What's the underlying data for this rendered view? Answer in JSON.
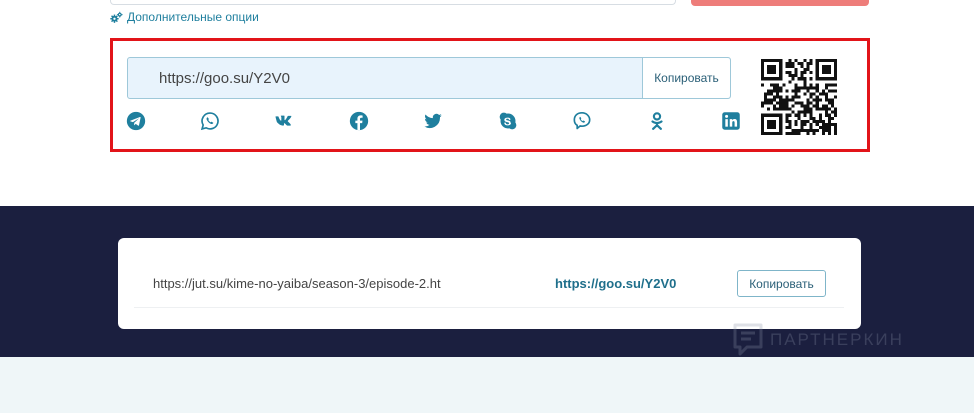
{
  "options": {
    "label": "Дополнительные опции",
    "icon": "gears-icon"
  },
  "result": {
    "short_url": "https://goo.su/Y2V0",
    "copy_label": "Копировать",
    "accent_color": "#e21419",
    "share_icons": [
      "telegram-icon",
      "whatsapp-icon",
      "vk-icon",
      "facebook-icon",
      "twitter-icon",
      "skype-icon",
      "viber-icon",
      "odnoklassniki-icon",
      "linkedin-icon"
    ],
    "qr_code": "qr-code"
  },
  "history": {
    "rows": [
      {
        "original_url": "https://jut.su/kime-no-yaiba/season-3/episode-2.ht",
        "short_url": "https://goo.su/Y2V0",
        "copy_label": "Копировать"
      }
    ]
  },
  "watermark": {
    "text": "ПАРТНЕРКИН"
  }
}
